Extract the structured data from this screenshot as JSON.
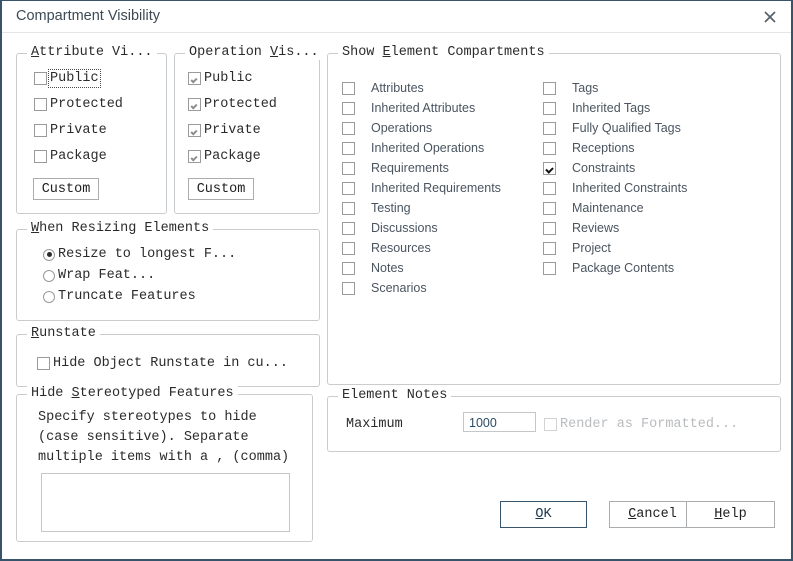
{
  "window": {
    "title": "Compartment Visibility",
    "close_icon": "close-icon"
  },
  "attribute_visibility": {
    "title_prefix": "A",
    "title_rest": "ttribute Vi...",
    "items": [
      {
        "label": "Public",
        "checked": false,
        "focused": true
      },
      {
        "label": "Protected",
        "checked": false,
        "focused": false
      },
      {
        "label": "Private",
        "checked": false,
        "focused": false
      },
      {
        "label": "Package",
        "checked": false,
        "focused": false
      }
    ],
    "custom_label": "Custom"
  },
  "operation_visibility": {
    "title_head": "Operation ",
    "title_accel": "V",
    "title_tail": "is...",
    "items": [
      {
        "label": "Public",
        "checked": true
      },
      {
        "label": "Protected",
        "checked": true
      },
      {
        "label": "Private",
        "checked": true
      },
      {
        "label": "Package",
        "checked": true
      }
    ],
    "custom_label": "Custom"
  },
  "show_element_compartments": {
    "title_head": "Show ",
    "title_accel": "E",
    "title_tail": "lement Compartments",
    "left_column": [
      {
        "label": "Attributes",
        "checked": false
      },
      {
        "label": "Inherited Attributes",
        "checked": false
      },
      {
        "label": "Operations",
        "checked": false
      },
      {
        "label": "Inherited Operations",
        "checked": false
      },
      {
        "label": "Requirements",
        "checked": false
      },
      {
        "label": "Inherited Requirements",
        "checked": false
      },
      {
        "label": "Testing",
        "checked": false
      },
      {
        "label": "Discussions",
        "checked": false
      },
      {
        "label": "Resources",
        "checked": false
      },
      {
        "label": "Notes",
        "checked": false
      },
      {
        "label": "Scenarios",
        "checked": false
      }
    ],
    "right_column": [
      {
        "label": "Tags",
        "checked": false
      },
      {
        "label": "Inherited Tags",
        "checked": false
      },
      {
        "label": "Fully Qualified Tags",
        "checked": false
      },
      {
        "label": "Receptions",
        "checked": false
      },
      {
        "label": "Constraints",
        "checked": true
      },
      {
        "label": "Inherited Constraints",
        "checked": false
      },
      {
        "label": "Maintenance",
        "checked": false
      },
      {
        "label": "Reviews",
        "checked": false
      },
      {
        "label": "Project",
        "checked": false
      },
      {
        "label": "Package Contents",
        "checked": false
      }
    ]
  },
  "when_resizing_elements": {
    "title_accel": "W",
    "title_tail": "hen Resizing Elements",
    "options": [
      {
        "label": "Resize to longest F...",
        "selected": true
      },
      {
        "label": "Wrap Feat...",
        "selected": false
      },
      {
        "label": "Truncate Features",
        "selected": false
      }
    ]
  },
  "runstate": {
    "title_accel": "R",
    "title_tail": "unstate",
    "checkbox": {
      "label": "Hide Object Runstate in cu...",
      "checked": false
    }
  },
  "hide_stereotyped_features": {
    "title_head": "Hide ",
    "title_accel": "S",
    "title_tail": "tereotyped Features",
    "description_line1": "Specify stereotypes to hide",
    "description_line2": "(case sensitive). Separate",
    "description_line3": "multiple items with a , (comma)",
    "input_value": ""
  },
  "element_notes": {
    "title": "Element Notes",
    "maximum_label": "Maximum",
    "maximum_value": "1000",
    "render_checkbox": {
      "label": "Render as Formatted...",
      "checked": false,
      "disabled": true
    }
  },
  "footer": {
    "ok": {
      "accel": "O",
      "rest": "K"
    },
    "cancel": {
      "accel": "C",
      "rest": "ancel"
    },
    "help": {
      "accel": "H",
      "rest": "elp"
    }
  }
}
